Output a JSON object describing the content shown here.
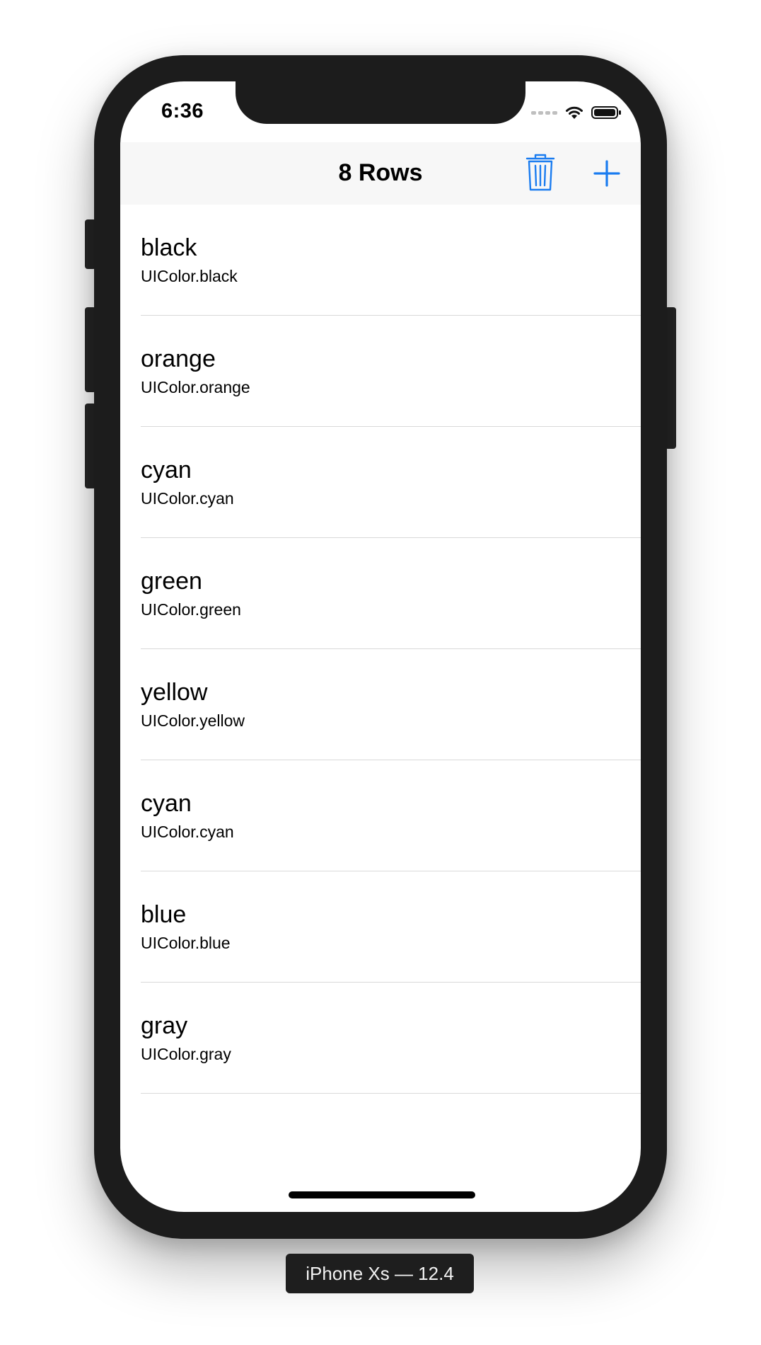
{
  "status_bar": {
    "time": "6:36"
  },
  "nav_bar": {
    "title": "8 Rows",
    "trash_icon": "trash-icon",
    "add_icon": "plus-icon",
    "accent_color": "#1a7cf0"
  },
  "rows": [
    {
      "title": "black",
      "subtitle": "UIColor.black"
    },
    {
      "title": "orange",
      "subtitle": "UIColor.orange"
    },
    {
      "title": "cyan",
      "subtitle": "UIColor.cyan"
    },
    {
      "title": "green",
      "subtitle": "UIColor.green"
    },
    {
      "title": "yellow",
      "subtitle": "UIColor.yellow"
    },
    {
      "title": "cyan",
      "subtitle": "UIColor.cyan"
    },
    {
      "title": "blue",
      "subtitle": "UIColor.blue"
    },
    {
      "title": "gray",
      "subtitle": "UIColor.gray"
    }
  ],
  "device_label": "iPhone Xs — 12.4"
}
